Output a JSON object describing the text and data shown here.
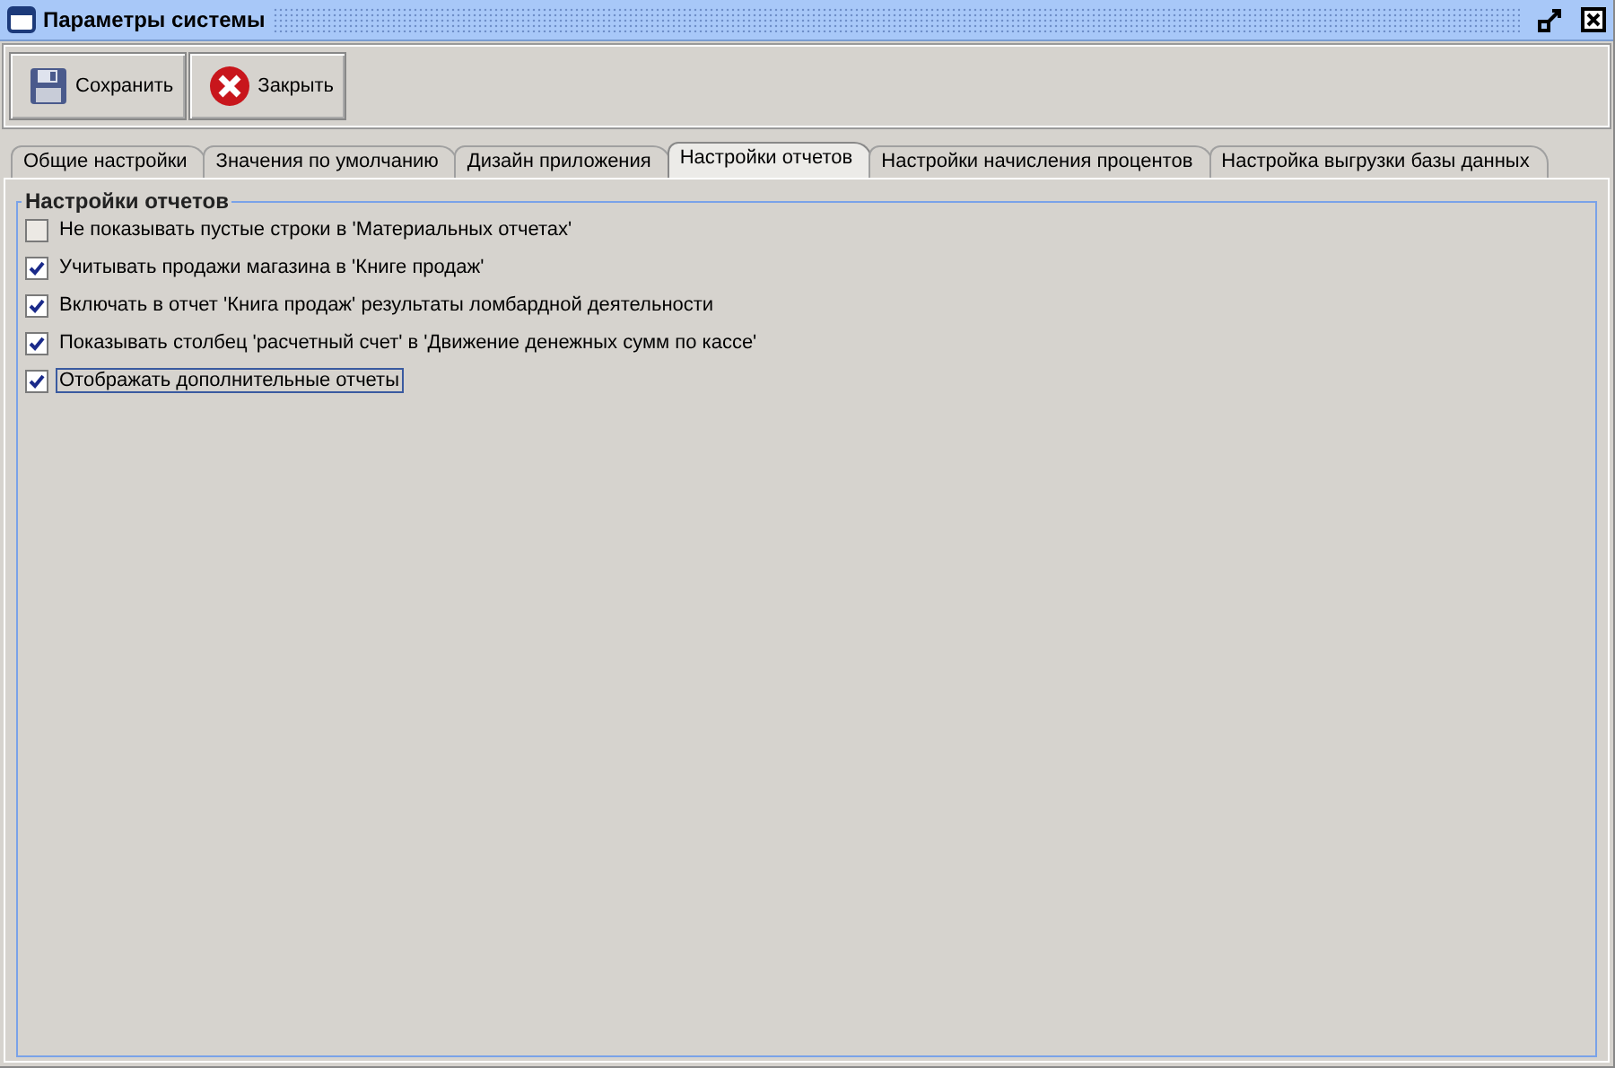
{
  "window": {
    "title": "Параметры системы"
  },
  "toolbar": [
    {
      "label": "Сохранить",
      "kind": "save"
    },
    {
      "label": "Закрыть",
      "kind": "close"
    }
  ],
  "tabs": [
    {
      "label": "Общие настройки",
      "selected": false
    },
    {
      "label": "Значения по умолчанию",
      "selected": false
    },
    {
      "label": "Дизайн приложения",
      "selected": false
    },
    {
      "label": "Настройки отчетов",
      "selected": true
    },
    {
      "label": "Настройки начисления процентов",
      "selected": false
    },
    {
      "label": "Настройка выгрузки базы данных",
      "selected": false
    }
  ],
  "group": {
    "title": "Настройки отчетов",
    "options": [
      {
        "label": "Не показывать пустые строки в 'Материальных отчетах'",
        "checked": false,
        "focused": false
      },
      {
        "label": "Учитывать продажи магазина в 'Книге продаж'",
        "checked": true,
        "focused": false
      },
      {
        "label": "Включать в отчет 'Книга продаж' результаты ломбардной деятельности",
        "checked": true,
        "focused": false
      },
      {
        "label": "Показывать столбец 'расчетный счет' в 'Движение денежных сумм по кассе'",
        "checked": true,
        "focused": false
      },
      {
        "label": "Отображать дополнительные отчеты",
        "checked": true,
        "focused": true
      }
    ]
  }
}
